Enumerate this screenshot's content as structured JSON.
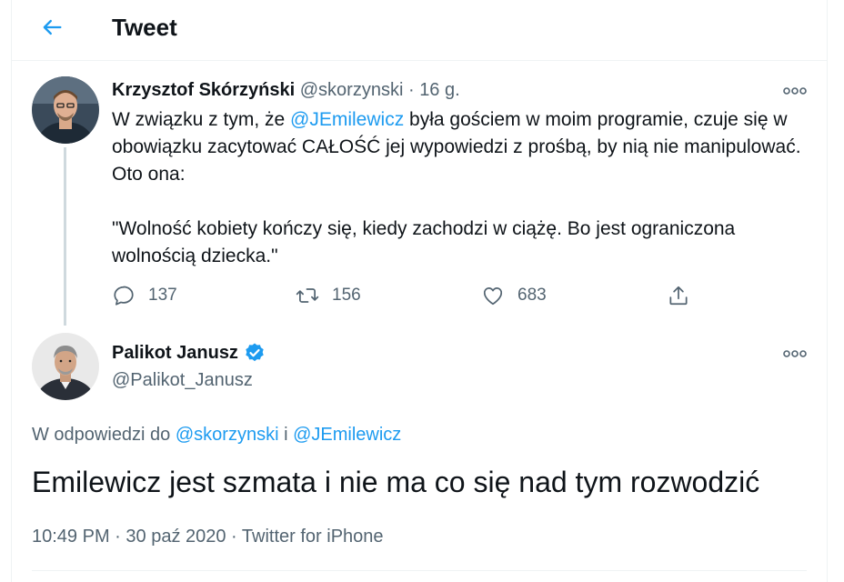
{
  "header": {
    "title": "Tweet",
    "back_icon": "arrow-left-icon"
  },
  "colors": {
    "accent": "#1d9bf0",
    "muted": "#536471",
    "text": "#0f1419",
    "divider": "#eff3f4"
  },
  "tweet1": {
    "author_name": "Krzysztof Skórzyński",
    "handle": "@skorzynski",
    "separator": "·",
    "time": "16 g.",
    "body_prefix": "W związku z tym, że ",
    "mention": "@JEmilewicz",
    "body_rest": " była gościem w moim programie, czuje się w obowiązku zacytować CAŁOŚĆ jej wypowiedzi z prośbą, by nią nie manipulować. Oto ona:",
    "quote": "\"Wolność kobiety kończy się, kiedy zachodzi w ciążę. Bo jest ograniczona wolnością dziecka.\"",
    "replies": "137",
    "retweets": "156",
    "likes": "683"
  },
  "tweet2": {
    "author_name": "Palikot Janusz",
    "handle": "@Palikot_Janusz",
    "verified": true,
    "replying_prefix": "W odpowiedzi do ",
    "replying_user1": "@skorzynski",
    "replying_and": " i ",
    "replying_user2": "@JEmilewicz",
    "body": "Emilewicz jest szmata i nie ma co się nad tym rozwodzić",
    "time": "10:49 PM",
    "meta_sep1": " · ",
    "date": "30 paź 2020",
    "meta_sep2": " · ",
    "source": "Twitter for iPhone"
  }
}
